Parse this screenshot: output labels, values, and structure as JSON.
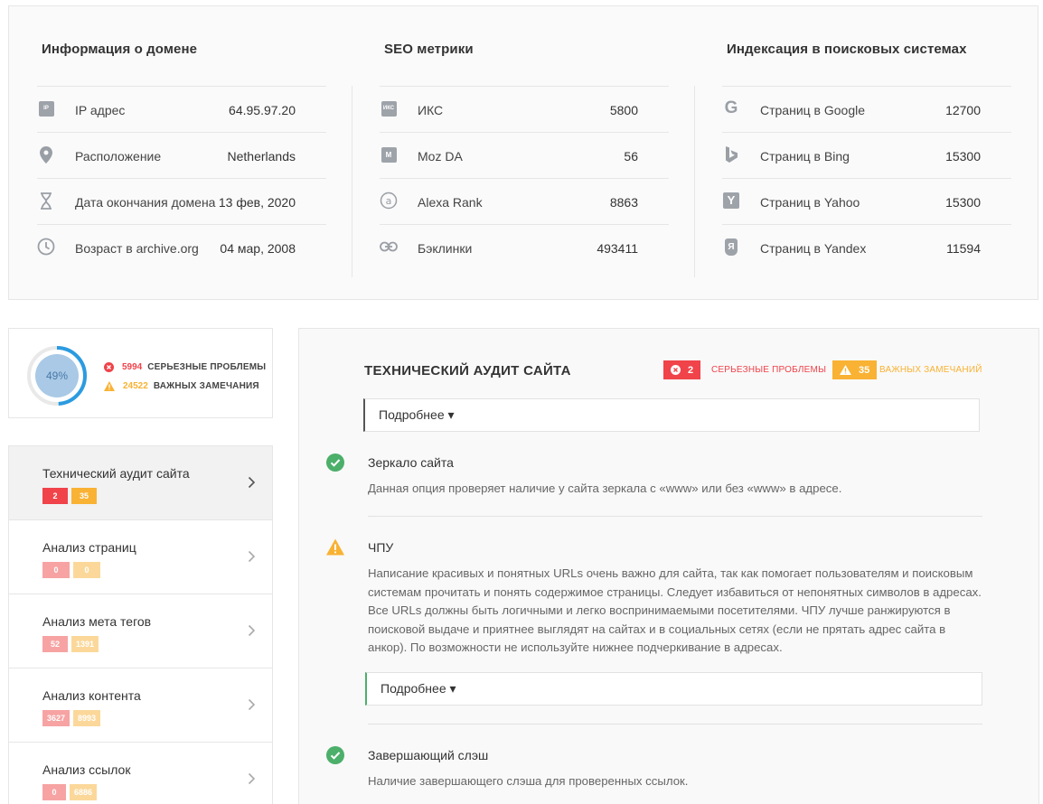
{
  "domain_info": {
    "title": "Информация о домене",
    "rows": [
      {
        "icon": "ip-icon",
        "badge": "IP",
        "label": "IP адрес",
        "value": "64.95.97.20"
      },
      {
        "icon": "location-pin-icon",
        "label": "Расположение",
        "value": "Netherlands"
      },
      {
        "icon": "hourglass-icon",
        "label": "Дата окончания домена",
        "value": "13 фев, 2020"
      },
      {
        "icon": "clock-icon",
        "label": "Возраст в archive.org",
        "value": "04 мар, 2008"
      }
    ]
  },
  "seo_metrics": {
    "title": "SEO метрики",
    "rows": [
      {
        "icon": "iks-icon",
        "badge": "ИКС",
        "label": "ИКС",
        "value": "5800"
      },
      {
        "icon": "moz-icon",
        "badge": "M",
        "label": "Moz DA",
        "value": "56"
      },
      {
        "icon": "alexa-icon",
        "badge": "a",
        "label": "Alexa Rank",
        "value": "8863"
      },
      {
        "icon": "link-icon",
        "label": "Бэклинки",
        "value": "493411"
      }
    ]
  },
  "indexation": {
    "title": "Индексация в поисковых системах",
    "rows": [
      {
        "icon": "google-icon",
        "glyph": "G",
        "label": "Страниц в Google",
        "value": "12700"
      },
      {
        "icon": "bing-icon",
        "glyph": "b",
        "label": "Страниц в Bing",
        "value": "15300"
      },
      {
        "icon": "yahoo-icon",
        "glyph": "Y",
        "label": "Страниц в Yahoo",
        "value": "15300"
      },
      {
        "icon": "yandex-icon",
        "glyph": "Я",
        "label": "Страниц в Yandex",
        "value": "11594"
      }
    ]
  },
  "score": {
    "percent": 49,
    "percent_label": "49%",
    "serious_count": "5994",
    "serious_label": "СЕРЬЕЗНЫЕ ПРОБЛЕМЫ",
    "warning_count": "24522",
    "warning_label": "ВАЖНЫХ ЗАМЕЧАНИЯ"
  },
  "sidebar": [
    {
      "title": "Технический аудит сайта",
      "errors": "2",
      "warnings": "35",
      "active": true
    },
    {
      "title": "Анализ страниц",
      "errors": "0",
      "warnings": "0"
    },
    {
      "title": "Анализ мета тегов",
      "errors": "52",
      "warnings": "1391"
    },
    {
      "title": "Анализ контента",
      "errors": "3627",
      "warnings": "8993"
    },
    {
      "title": "Анализ ссылок",
      "errors": "0",
      "warnings": "6886"
    }
  ],
  "audit": {
    "title": "ТЕХНИЧЕСКИЙ АУДИТ САЙТА",
    "error_count": "2",
    "error_label": "СЕРЬЕЗНЫЕ ПРОБЛЕМЫ",
    "warning_count": "35",
    "warning_label": "ВАЖНЫХ ЗАМЕЧАНИЙ",
    "details_label": "Подробнее ▾",
    "items": [
      {
        "status": "ok",
        "title": "Зеркало сайта",
        "description": "Данная опция проверяет наличие у сайта зеркала с «www» или без «www» в адресе."
      },
      {
        "status": "warning",
        "title": "ЧПУ",
        "description": "Написание красивых и понятных URLs очень важно для сайта, так как помогает пользователям и поисковым системам прочитать и понять содержимое страницы. Следует избавиться от непонятных символов в адресах. Все URLs должны быть логичными и легко воспринимаемыми посетителями. ЧПУ лучше ранжируются в поисковой выдаче и приятнее выглядят на сайтах и в социальных сетях (если не прятать адрес сайта в анкор). По возможности не используйте нижнее подчеркивание в адресах.",
        "details_label": "Подробнее ▾"
      },
      {
        "status": "ok",
        "title": "Завершающий слэш",
        "description": "Наличие завершающего слэша для проверенных ссылок."
      }
    ]
  },
  "colors": {
    "error": "#f0434a",
    "warning": "#f9b233",
    "ok": "#4caf6a",
    "error_light": "#f7a3a3",
    "warning_light": "#fbd89a",
    "gauge": "#2b9be0",
    "gauge_fill": "#a9c9e6"
  }
}
